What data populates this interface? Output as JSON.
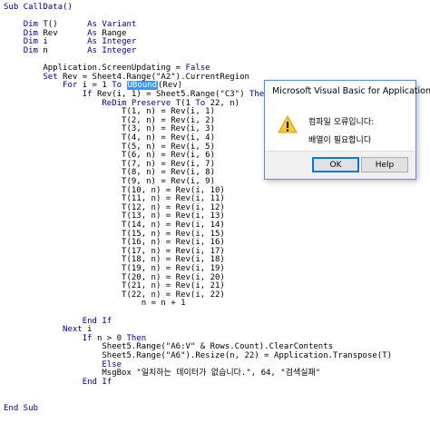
{
  "code": {
    "lines": [
      {
        "parts": [
          {
            "t": "Sub CallData()",
            "k": 1
          }
        ]
      },
      {
        "parts": [
          {
            "t": ""
          }
        ]
      },
      {
        "parts": [
          {
            "t": "    "
          },
          {
            "t": "Dim",
            "k": 1
          },
          {
            "t": " T()      "
          },
          {
            "t": "As",
            "k": 1
          },
          {
            "t": " "
          },
          {
            "t": "Variant",
            "k": 1
          }
        ]
      },
      {
        "parts": [
          {
            "t": "    "
          },
          {
            "t": "Dim",
            "k": 1
          },
          {
            "t": " Rev      "
          },
          {
            "t": "As",
            "k": 1
          },
          {
            "t": " Range"
          }
        ]
      },
      {
        "parts": [
          {
            "t": "    "
          },
          {
            "t": "Dim",
            "k": 1
          },
          {
            "t": " i        "
          },
          {
            "t": "As",
            "k": 1
          },
          {
            "t": " "
          },
          {
            "t": "Integer",
            "k": 1
          }
        ]
      },
      {
        "parts": [
          {
            "t": "    "
          },
          {
            "t": "Dim",
            "k": 1
          },
          {
            "t": " n        "
          },
          {
            "t": "As",
            "k": 1
          },
          {
            "t": " "
          },
          {
            "t": "Integer",
            "k": 1
          }
        ]
      },
      {
        "parts": [
          {
            "t": ""
          }
        ]
      },
      {
        "parts": [
          {
            "t": "        Application.ScreenUpdating = "
          },
          {
            "t": "False",
            "k": 1
          }
        ]
      },
      {
        "parts": [
          {
            "t": "        "
          },
          {
            "t": "Set",
            "k": 1
          },
          {
            "t": " Rev = Sheet4.Range(\"A2\").CurrentRegion"
          }
        ]
      },
      {
        "parts": [
          {
            "t": "            "
          },
          {
            "t": "For",
            "k": 1
          },
          {
            "t": " i = 1 "
          },
          {
            "t": "To",
            "k": 1
          },
          {
            "t": " "
          },
          {
            "t": "UBound",
            "s": 1
          },
          {
            "t": "(Rev)"
          }
        ]
      },
      {
        "parts": [
          {
            "t": "                "
          },
          {
            "t": "If",
            "k": 1
          },
          {
            "t": " Rev(i, 1) = Sheet5.Range(\"C3\") "
          },
          {
            "t": "Then",
            "k": 1
          }
        ]
      },
      {
        "parts": [
          {
            "t": "                    "
          },
          {
            "t": "ReDim Preserve",
            "k": 1
          },
          {
            "t": " T(1 "
          },
          {
            "t": "To",
            "k": 1
          },
          {
            "t": " 22, n)"
          }
        ]
      },
      {
        "parts": [
          {
            "t": "                        T(1, n) = Rev(i, 1)"
          }
        ]
      },
      {
        "parts": [
          {
            "t": "                        T(2, n) = Rev(i, 2)"
          }
        ]
      },
      {
        "parts": [
          {
            "t": "                        T(3, n) = Rev(i, 3)"
          }
        ]
      },
      {
        "parts": [
          {
            "t": "                        T(4, n) = Rev(i, 4)"
          }
        ]
      },
      {
        "parts": [
          {
            "t": "                        T(5, n) = Rev(i, 5)"
          }
        ]
      },
      {
        "parts": [
          {
            "t": "                        T(6, n) = Rev(i, 6)"
          }
        ]
      },
      {
        "parts": [
          {
            "t": "                        T(7, n) = Rev(i, 7)"
          }
        ]
      },
      {
        "parts": [
          {
            "t": "                        T(8, n) = Rev(i, 8)"
          }
        ]
      },
      {
        "parts": [
          {
            "t": "                        T(9, n) = Rev(i, 9)"
          }
        ]
      },
      {
        "parts": [
          {
            "t": "                        T(10, n) = Rev(i, 10)"
          }
        ]
      },
      {
        "parts": [
          {
            "t": "                        T(11, n) = Rev(i, 11)"
          }
        ]
      },
      {
        "parts": [
          {
            "t": "                        T(12, n) = Rev(i, 12)"
          }
        ]
      },
      {
        "parts": [
          {
            "t": "                        T(13, n) = Rev(i, 13)"
          }
        ]
      },
      {
        "parts": [
          {
            "t": "                        T(14, n) = Rev(i, 14)"
          }
        ]
      },
      {
        "parts": [
          {
            "t": "                        T(15, n) = Rev(i, 15)"
          }
        ]
      },
      {
        "parts": [
          {
            "t": "                        T(16, n) = Rev(i, 16)"
          }
        ]
      },
      {
        "parts": [
          {
            "t": "                        T(17, n) = Rev(i, 17)"
          }
        ]
      },
      {
        "parts": [
          {
            "t": "                        T(18, n) = Rev(i, 18)"
          }
        ]
      },
      {
        "parts": [
          {
            "t": "                        T(19, n) = Rev(i, 19)"
          }
        ]
      },
      {
        "parts": [
          {
            "t": "                        T(20, n) = Rev(i, 20)"
          }
        ]
      },
      {
        "parts": [
          {
            "t": "                        T(21, n) = Rev(i, 21)"
          }
        ]
      },
      {
        "parts": [
          {
            "t": "                        T(22, n) = Rev(i, 22)"
          }
        ]
      },
      {
        "parts": [
          {
            "t": "                            n = n + 1"
          }
        ]
      },
      {
        "parts": [
          {
            "t": ""
          }
        ]
      },
      {
        "parts": [
          {
            "t": "                "
          },
          {
            "t": "End If",
            "k": 1
          }
        ]
      },
      {
        "parts": [
          {
            "t": "            "
          },
          {
            "t": "Next",
            "k": 1
          },
          {
            "t": " i"
          }
        ]
      },
      {
        "parts": [
          {
            "t": "                "
          },
          {
            "t": "If",
            "k": 1
          },
          {
            "t": " n > 0 "
          },
          {
            "t": "Then",
            "k": 1
          }
        ]
      },
      {
        "parts": [
          {
            "t": "                    Sheet5.Range(\"A6:V\" & Rows.Count).ClearContents"
          }
        ]
      },
      {
        "parts": [
          {
            "t": "                    Sheet5.Range(\"A6\").Resize(n, 22) = Application.Transpose(T)"
          }
        ]
      },
      {
        "parts": [
          {
            "t": "                    "
          },
          {
            "t": "Else",
            "k": 1
          }
        ]
      },
      {
        "parts": [
          {
            "t": "                    MsgBox \"일치하는 데이터가 없습니다.\", 64, \"검색실패\""
          }
        ]
      },
      {
        "parts": [
          {
            "t": "                "
          },
          {
            "t": "End If",
            "k": 1
          }
        ]
      },
      {
        "parts": [
          {
            "t": ""
          }
        ]
      },
      {
        "parts": [
          {
            "t": ""
          }
        ]
      },
      {
        "parts": [
          {
            "t": "End Sub",
            "k": 1
          }
        ]
      }
    ]
  },
  "dialog": {
    "title": "Microsoft Visual Basic for Applications",
    "message_line1": "컴파일 오류입니다:",
    "message_line2": "배열이 필요합니다",
    "ok_label": "OK",
    "help_label": "Help",
    "icon": "warning-icon"
  },
  "colors": {
    "keyword": "#00008b",
    "selection": "#3399ff",
    "dialog_border": "#5a8ed6",
    "warning_fill": "#f7c92f"
  }
}
